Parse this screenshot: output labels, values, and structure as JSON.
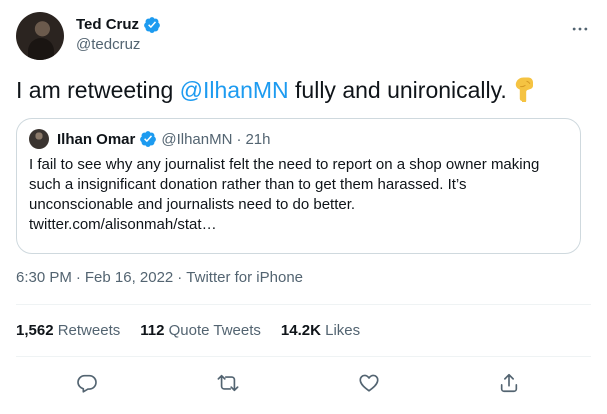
{
  "author": {
    "display_name": "Ted Cruz",
    "handle": "@tedcruz"
  },
  "tweet": {
    "text_before": "I am retweeting ",
    "mention": "@IlhanMN",
    "text_after": " fully and unironically."
  },
  "quote": {
    "display_name": "Ilhan Omar",
    "handle": "@IlhanMN",
    "separator": "·",
    "time": "21h",
    "body": "I fail to see why any journalist felt the need to report on a shop owner making such a insignificant donation rather than to get them harassed. It’s unconscionable and journalists need to do better.",
    "link": "twitter.com/alisonmah/stat…"
  },
  "meta": {
    "time": "6:30 PM",
    "sep1": "·",
    "date": "Feb 16, 2022",
    "sep2": "·",
    "source": "Twitter for iPhone"
  },
  "stats": {
    "retweets_count": "1,562",
    "retweets_label": "Retweets",
    "quotes_count": "112",
    "quotes_label": "Quote Tweets",
    "likes_count": "14.2K",
    "likes_label": "Likes"
  },
  "colors": {
    "accent": "#1d9bf0",
    "text": "#0f1419",
    "muted": "#536471",
    "border": "#cfd9de"
  },
  "icons": {
    "verified": "verified-badge-icon",
    "more": "more-horizontal-icon",
    "emoji": "backhand-index-pointing-down-emoji",
    "reply": "reply-icon",
    "retweet": "retweet-icon",
    "like": "heart-icon",
    "share": "share-icon"
  }
}
